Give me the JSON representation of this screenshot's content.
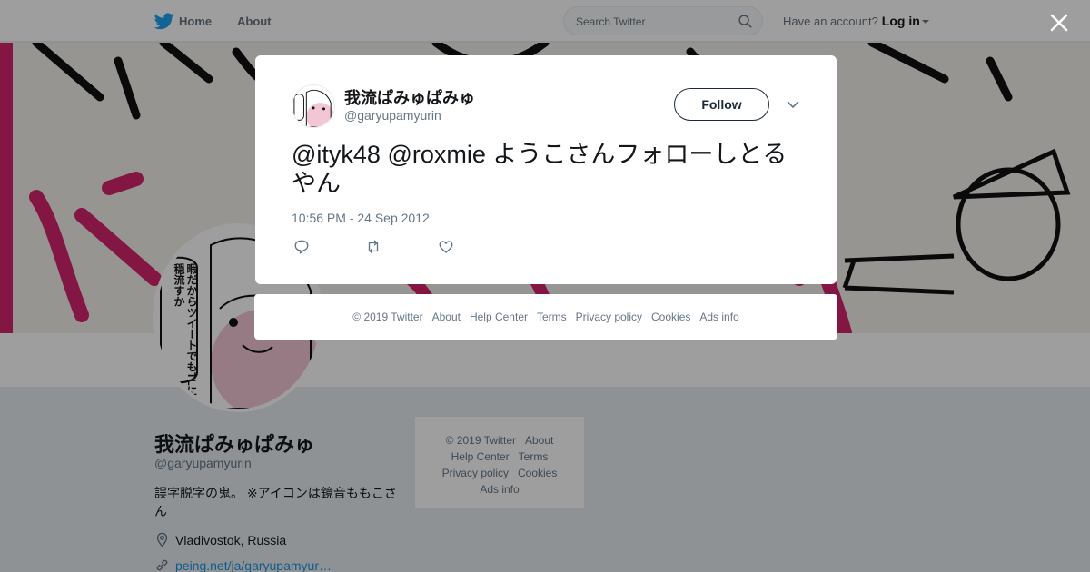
{
  "topbar": {
    "home_label": "Home",
    "about_label": "About",
    "search_placeholder": "Search Twitter",
    "account_prompt": "Have an account?",
    "login_label": "Log in"
  },
  "profile": {
    "name": "我流ぱみゅぱみゅ",
    "handle": "@garyupamyurin",
    "bio": "誤字脱字の鬼。 ※アイコンは鏡音ももこさん",
    "location": "Vladivostok, Russia",
    "url": "peing.net/ja/garyupamyur…",
    "avatar_caption": "暇だからツイートでもTLに不穏流すか"
  },
  "page_footer": {
    "copyright": "© 2019 Twitter",
    "about": "About",
    "help": "Help Center",
    "terms": "Terms",
    "privacy": "Privacy policy",
    "cookies": "Cookies",
    "ads": "Ads info"
  },
  "tweet": {
    "author_name": "我流ぱみゅぱみゅ",
    "author_handle": "@garyupamyurin",
    "follow_label": "Follow",
    "text": "@ityk48 @roxmie ようこさんフォローしとるやん",
    "timestamp": "10:56 PM - 24 Sep 2012"
  },
  "modal_footer": {
    "copyright": "© 2019 Twitter",
    "about": "About",
    "help": "Help Center",
    "terms": "Terms",
    "privacy": "Privacy policy",
    "cookies": "Cookies",
    "ads": "Ads info"
  },
  "icons": {
    "brand": "twitter-bird-icon",
    "search": "search-icon",
    "close": "close-icon",
    "reply": "reply-icon",
    "retweet": "retweet-icon",
    "like": "heart-icon",
    "location": "location-pin-icon",
    "link": "link-icon"
  },
  "colors": {
    "brand_blue": "#1da1f2",
    "link_blue": "#1b95e0",
    "banner_magenta": "#d6246e"
  }
}
